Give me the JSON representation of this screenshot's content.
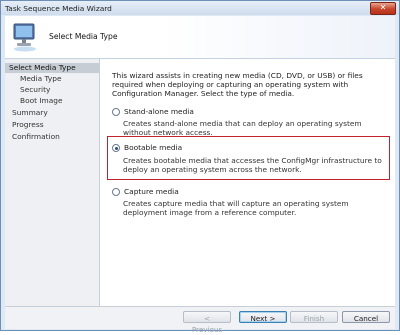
{
  "window": {
    "title": "Task Sequence Media Wizard",
    "close_glyph": "✕"
  },
  "header": {
    "title": "Select Media Type",
    "icon": "computer-wizard-icon"
  },
  "sidebar": {
    "items": [
      {
        "label": "Select Media Type",
        "active": true
      },
      {
        "label": "Media Type",
        "indent": true
      },
      {
        "label": "Security",
        "indent": true
      },
      {
        "label": "Boot Image",
        "indent": true
      },
      {
        "label": "Summary"
      },
      {
        "label": "Progress"
      },
      {
        "label": "Confirmation"
      }
    ]
  },
  "main": {
    "intro": "This wizard assists in creating new media (CD, DVD, or USB) or files required when deploying or capturing an operating system with Configuration Manager. Select the type of media.",
    "options": [
      {
        "label": "Stand-alone media",
        "description": "Creates stand-alone media that can deploy an operating system without network access.",
        "checked": false
      },
      {
        "label": "Bootable media",
        "description": "Creates bootable media that accesses the ConfigMgr infrastructure to deploy an operating system across the network.",
        "checked": true
      },
      {
        "label": "Capture media",
        "description": "Creates capture media that will capture an operating system deployment image from a reference computer.",
        "checked": false
      }
    ]
  },
  "footer": {
    "previous": "< Previous",
    "next": "Next >",
    "finish": "Finish",
    "cancel": "Cancel"
  },
  "colors": {
    "highlight": "#c2222e",
    "title_bar": "#cfdcec"
  }
}
